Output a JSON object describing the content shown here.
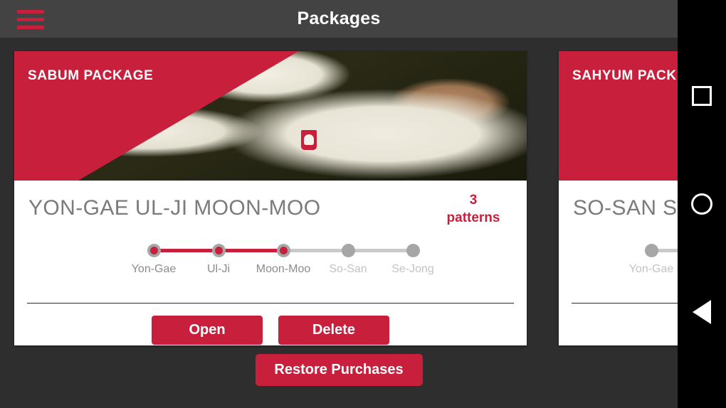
{
  "appbar": {
    "title": "Packages",
    "menu_icon": "hamburger-menu-icon",
    "bg_color": "#434343"
  },
  "theme": {
    "accent": "#c8203c",
    "background": "#2e2e2e",
    "card_background": "#ffffff",
    "step_done_ring": "#a6a6a6",
    "step_todo": "#a6a6a6",
    "label_done": "#8b8b8b",
    "label_todo": "#c3c3c3"
  },
  "packages": [
    {
      "banner_title": "SABUM PACKAGE",
      "name": "YON-GAE UL-JI MOON-MOO",
      "count_number": "3",
      "count_unit": "patterns",
      "banner_photo": "martial-artist-photo",
      "steps": [
        {
          "label": "Yon-Gae",
          "state": "done"
        },
        {
          "label": "Ul-Ji",
          "state": "done"
        },
        {
          "label": "Moon-Moo",
          "state": "done"
        },
        {
          "label": "So-San",
          "state": "todo"
        },
        {
          "label": "Se-Jong",
          "state": "todo"
        }
      ],
      "buttons": [
        {
          "label": "Open",
          "name": "open-button"
        },
        {
          "label": "Delete",
          "name": "delete-button"
        }
      ]
    },
    {
      "banner_title": "SAHYUM PACK",
      "name": "SO-SAN SE-",
      "count_number": "",
      "count_unit": "",
      "banner_photo": "",
      "steps": [
        {
          "label": "Yon-Gae",
          "state": "todo"
        }
      ],
      "buttons": []
    }
  ],
  "restore": {
    "label": "Restore Purchases"
  },
  "navbar": {
    "recents_icon": "square-recents-icon",
    "home_icon": "circle-home-icon",
    "back_icon": "triangle-back-icon"
  }
}
